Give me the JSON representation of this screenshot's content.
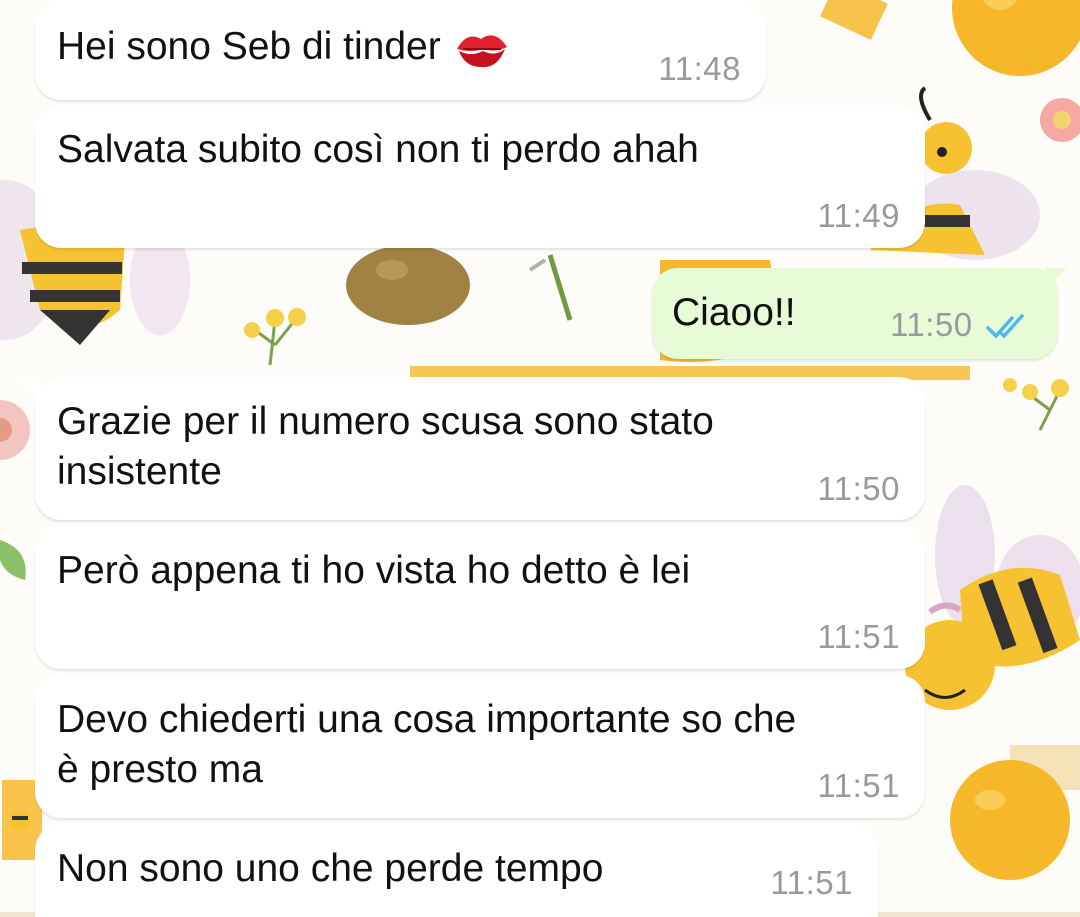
{
  "conversation": {
    "messages": [
      {
        "direction": "incoming",
        "text": "Hei sono Seb di tinder",
        "emoji": "kiss-mark-icon",
        "time": "11:48"
      },
      {
        "direction": "incoming",
        "text": "Salvata subito così non ti perdo ahah",
        "time": "11:49"
      },
      {
        "direction": "outgoing",
        "text": "Ciaoo!!",
        "time": "11:50",
        "status": "read"
      },
      {
        "direction": "incoming",
        "text": "Grazie per il numero scusa sono stato\ninsistente",
        "time": "11:50"
      },
      {
        "direction": "incoming",
        "text": "Però appena ti ho vista ho detto è lei",
        "time": "11:51"
      },
      {
        "direction": "incoming",
        "text": "Devo chiederti una cosa importante so che\nè presto ma",
        "time": "11:51"
      },
      {
        "direction": "incoming",
        "text": "Non sono uno che perde tempo",
        "time": "11:51"
      }
    ]
  },
  "theme": {
    "incoming_bubble": "#ffffff",
    "outgoing_bubble": "#e7fbd6",
    "read_check": "#4fb6ec",
    "time_color": "#9a9a9a",
    "wallpaper": "bee-and-honey-pattern"
  }
}
